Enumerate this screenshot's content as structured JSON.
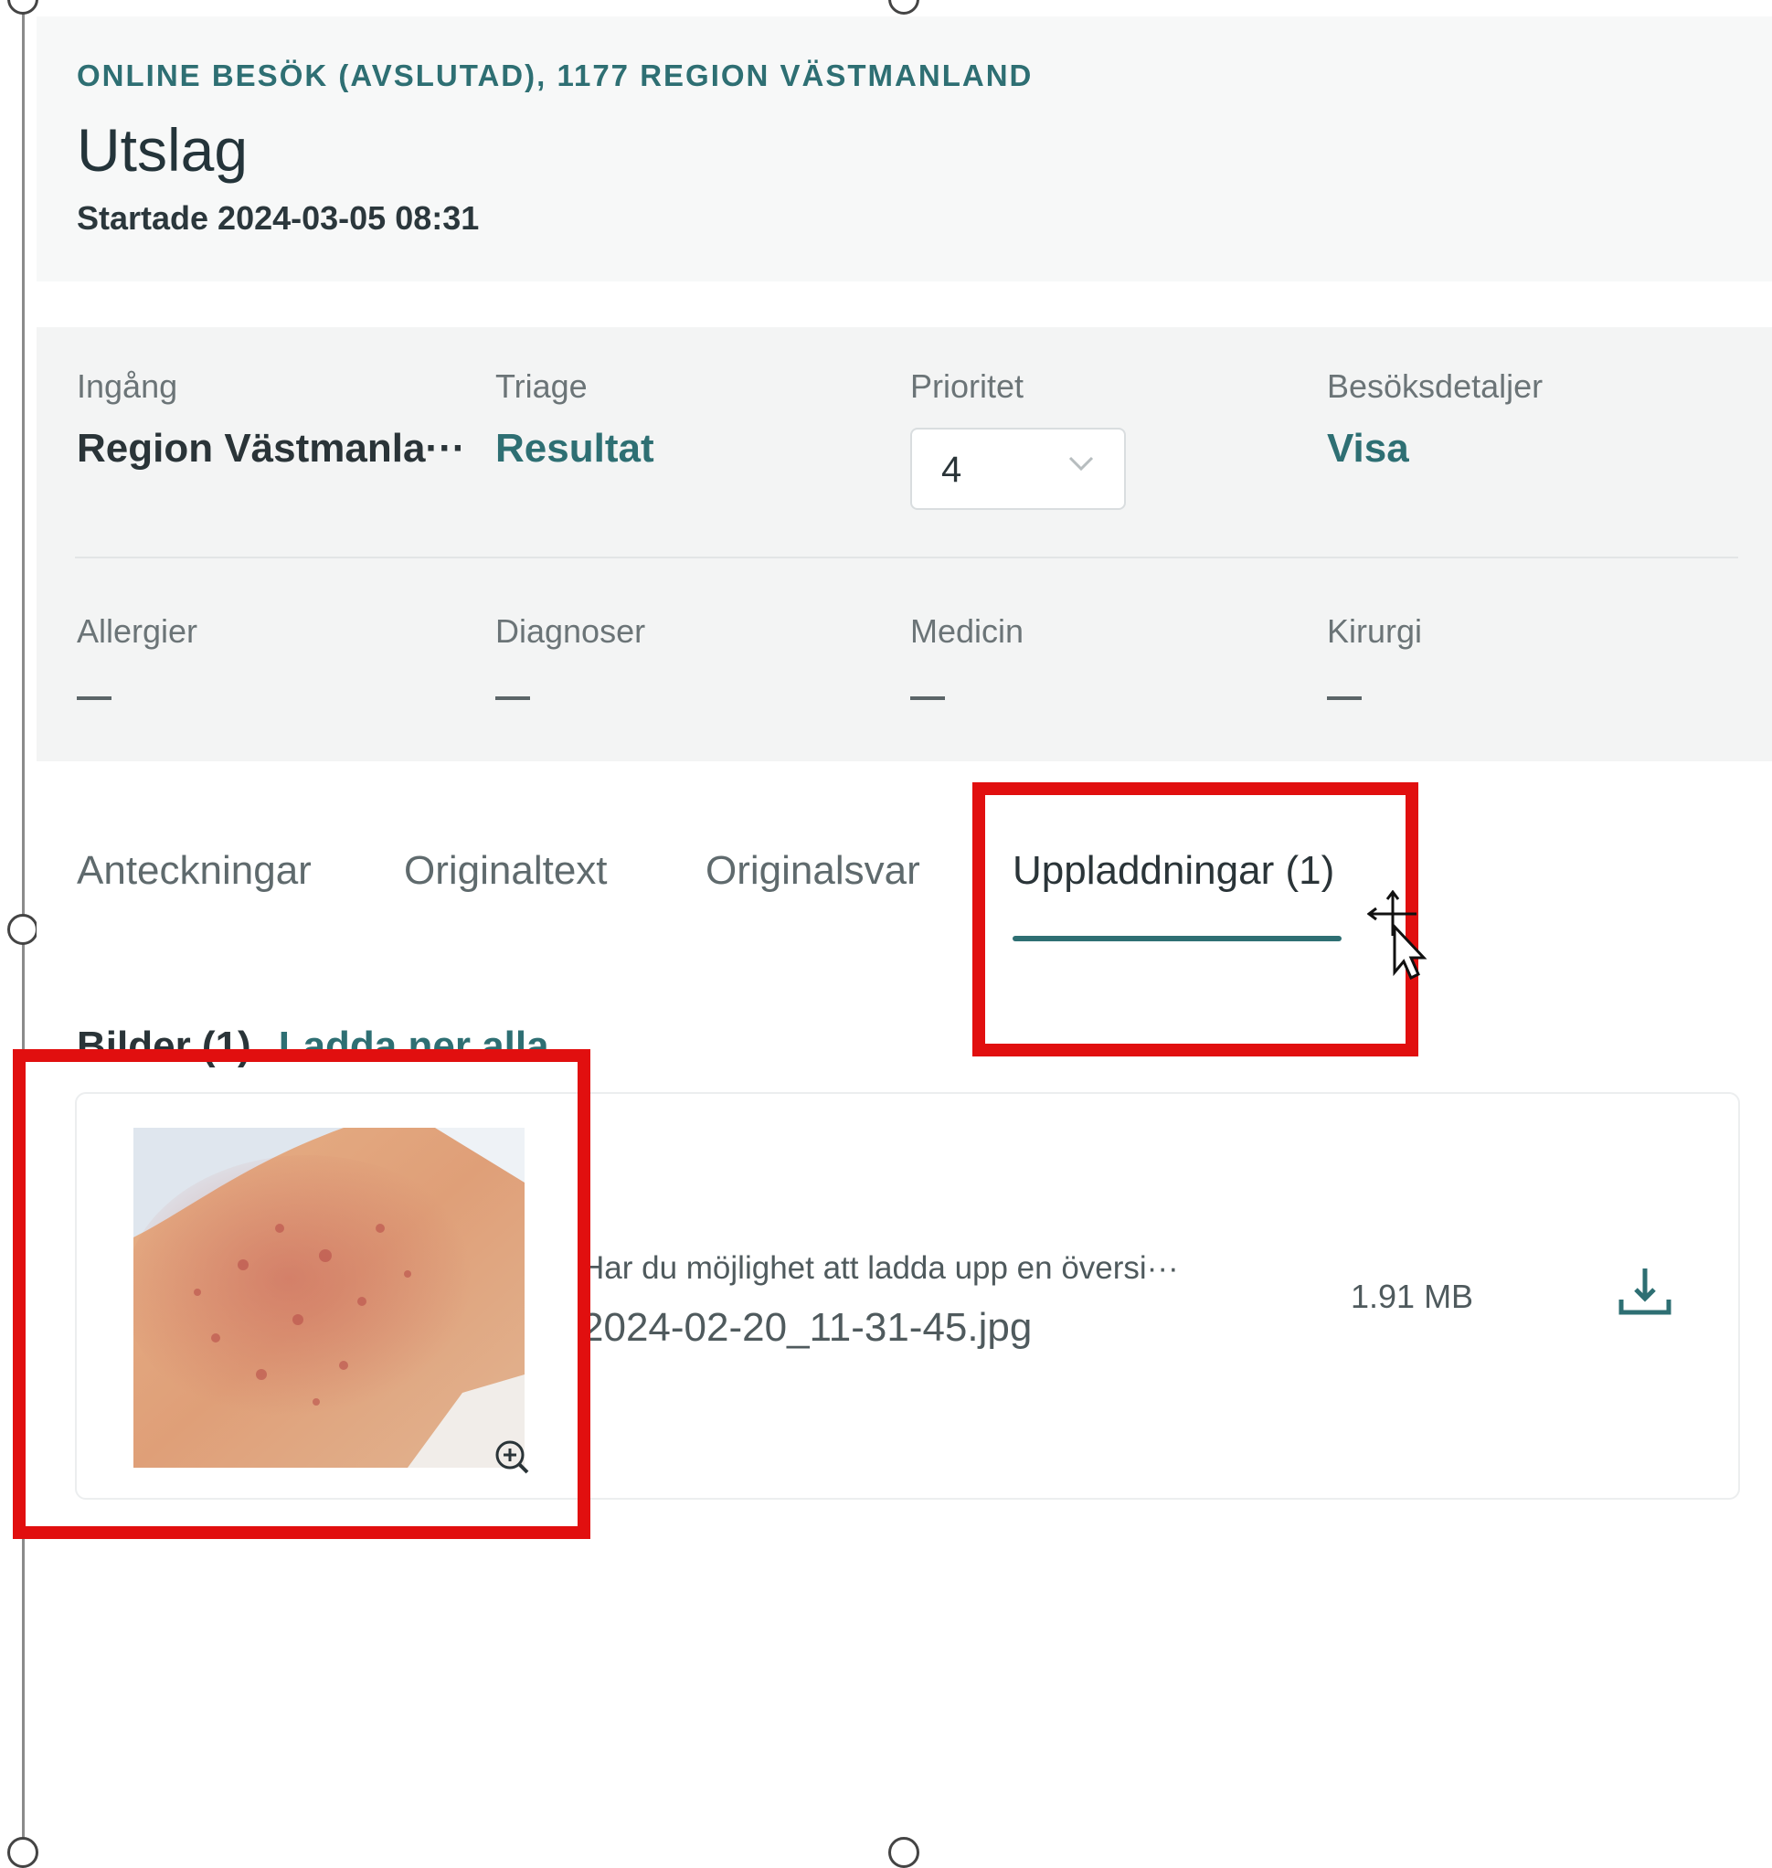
{
  "header": {
    "eyebrow": "ONLINE BESÖK (AVSLUTAD), 1177 REGION VÄSTMANLAND",
    "title": "Utslag",
    "started": "Startade 2024-03-05 08:31"
  },
  "info": {
    "row1": [
      {
        "label": "Ingång",
        "value": "Region Västmanla···"
      },
      {
        "label": "Triage",
        "value": "Resultat"
      },
      {
        "label": "Prioritet",
        "value": "4"
      },
      {
        "label": "Besöksdetaljer",
        "value": "Visa"
      }
    ],
    "row2": [
      {
        "label": "Allergier",
        "value": "—"
      },
      {
        "label": "Diagnoser",
        "value": "—"
      },
      {
        "label": "Medicin",
        "value": "—"
      },
      {
        "label": "Kirurgi",
        "value": "—"
      }
    ]
  },
  "tabs": [
    {
      "label": "Anteckningar"
    },
    {
      "label": "Originaltext"
    },
    {
      "label": "Originalsvar"
    },
    {
      "label": "Uppladdningar (1)",
      "active": true
    }
  ],
  "uploads": {
    "section_title": "Bilder (1)",
    "download_all": "Ladda ner alla",
    "items": [
      {
        "question": "Har du möjlighet att ladda upp en översi···",
        "filename": "2024-02-20_11-31-45.jpg",
        "size": "1.91 MB"
      }
    ]
  },
  "icons": {
    "zoom": "zoom-in-icon",
    "download": "download-icon",
    "chevron": "chevron-down-icon"
  },
  "colors": {
    "accent": "#2e6f73",
    "highlight": "#e10f0f"
  }
}
